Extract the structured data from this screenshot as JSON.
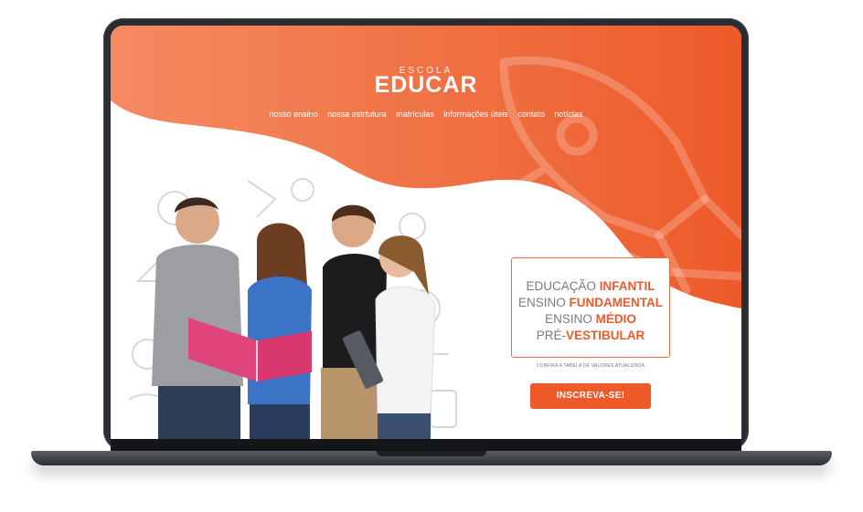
{
  "site": {
    "logo_small": "ESCOLA",
    "logo_big": "EDUCAR"
  },
  "nav": {
    "items": [
      {
        "label": "nosso ensino"
      },
      {
        "label": "nossa estrtutura"
      },
      {
        "label": "matrículas"
      },
      {
        "label": "informações úteis"
      },
      {
        "label": "contato"
      },
      {
        "label": "notícias"
      }
    ]
  },
  "courses": {
    "lines": [
      {
        "prefix": "EDUCAÇÃO ",
        "highlight": "INFANTIL"
      },
      {
        "prefix": "ENSINO ",
        "highlight": "FUNDAMENTAL"
      },
      {
        "prefix": "ENSINO ",
        "highlight": "MÉDIO"
      },
      {
        "prefix": "PRÉ-",
        "highlight": "VESTIBULAR"
      }
    ],
    "note": "CONFIRA A TABELA DE VALORES ATUALIZADA"
  },
  "cta": {
    "label": "INSCREVA-SE!"
  },
  "colors": {
    "brand_orange": "#ee5a2a",
    "hero_orange_light": "#f58a63",
    "laptop_frame": "#2b2d33"
  }
}
